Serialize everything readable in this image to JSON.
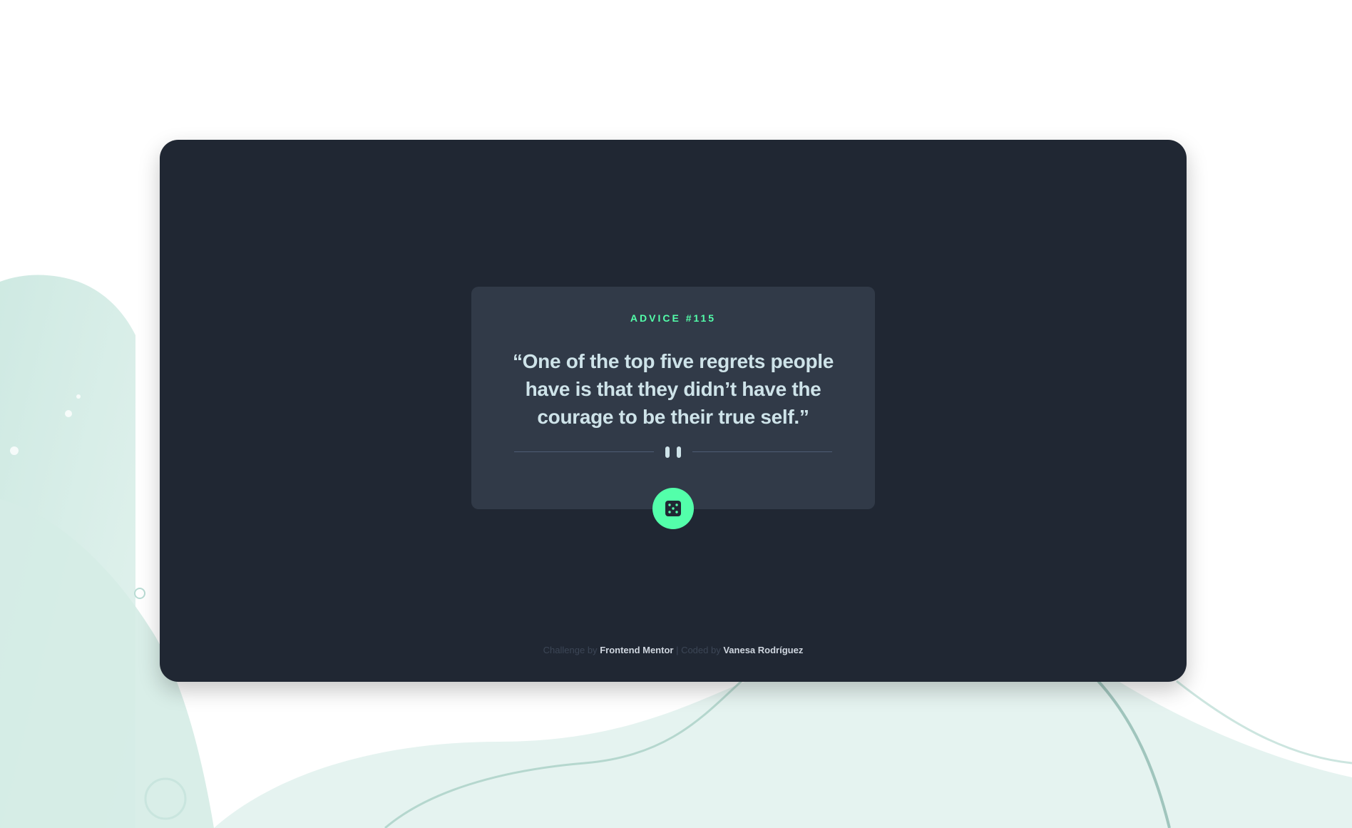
{
  "card": {
    "advice_label": "ADVICE #115",
    "quote": "“One of the top five regrets people have is that they didn’t have the courage to be their true self.”"
  },
  "icons": {
    "divider": "pause-icon",
    "dice": "dice-icon"
  },
  "footer": {
    "challenge_prefix": "Challenge by",
    "challenge_link": "Frontend Mentor",
    "coded_prefix": "| Coded by",
    "author_link": "Vanesa Rodríguez"
  },
  "colors": {
    "page_background": "#ffffff",
    "frame_background": "#202733",
    "card_background": "#313a48",
    "accent": "#53ffaa",
    "quote_text": "#cee3e9",
    "divider_line": "#4f5d74"
  }
}
